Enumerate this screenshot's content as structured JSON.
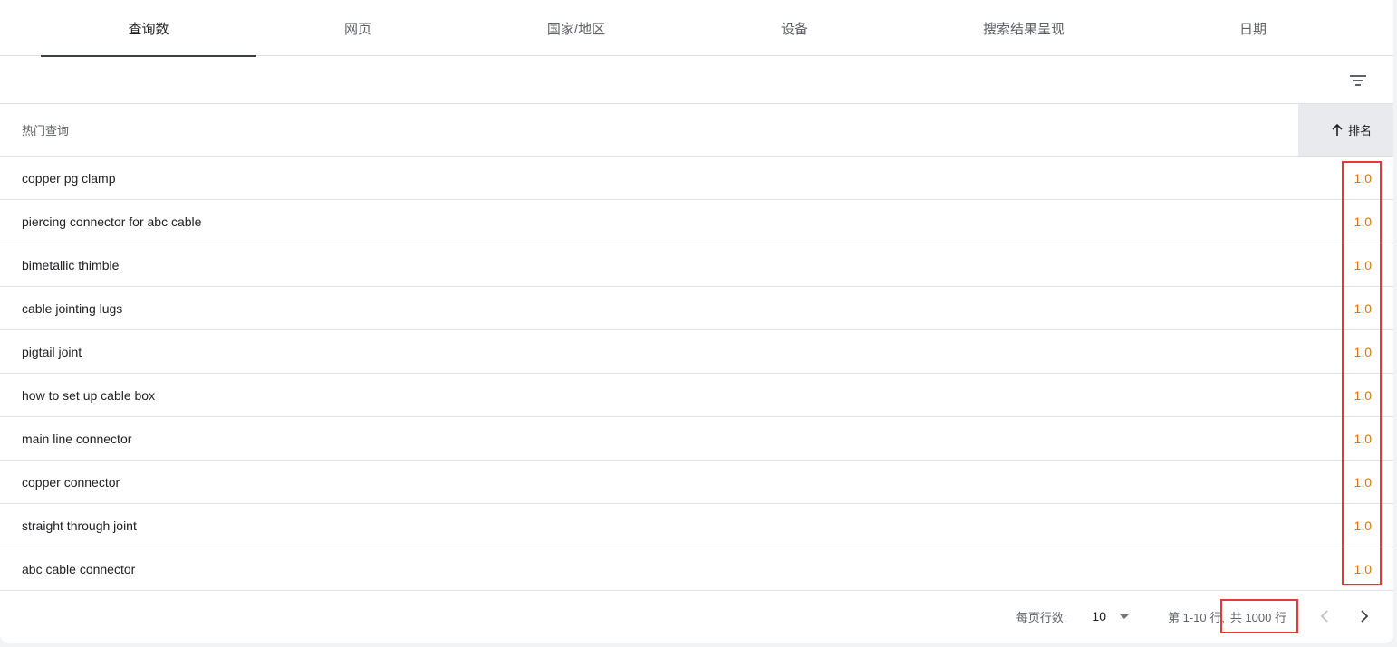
{
  "tabs": [
    {
      "label": "查询数",
      "active": true
    },
    {
      "label": "网页",
      "active": false
    },
    {
      "label": "国家/地区",
      "active": false
    },
    {
      "label": "设备",
      "active": false
    },
    {
      "label": "搜索结果呈现",
      "active": false
    },
    {
      "label": "日期",
      "active": false
    }
  ],
  "toolbar": {
    "filter_icon": "filter-list-icon"
  },
  "table": {
    "headers": {
      "query": "热门查询",
      "rank": "排名",
      "sort_icon": "arrow-up-icon"
    },
    "rows": [
      {
        "query": "copper pg clamp",
        "rank": "1.0"
      },
      {
        "query": "piercing connector for abc cable",
        "rank": "1.0"
      },
      {
        "query": "bimetallic thimble",
        "rank": "1.0"
      },
      {
        "query": "cable jointing lugs",
        "rank": "1.0"
      },
      {
        "query": "pigtail joint",
        "rank": "1.0"
      },
      {
        "query": "how to set up cable box",
        "rank": "1.0"
      },
      {
        "query": "main line connector",
        "rank": "1.0"
      },
      {
        "query": "copper connector",
        "rank": "1.0"
      },
      {
        "query": "straight through joint",
        "rank": "1.0"
      },
      {
        "query": "abc cable connector",
        "rank": "1.0"
      }
    ]
  },
  "footer": {
    "rows_per_page_label": "每页行数:",
    "rows_per_page_value": "10",
    "range": "第 1-10 行,",
    "total": "共 1000 行"
  },
  "colors": {
    "rank_value": "#e37400",
    "highlight_box": "#e53935"
  }
}
